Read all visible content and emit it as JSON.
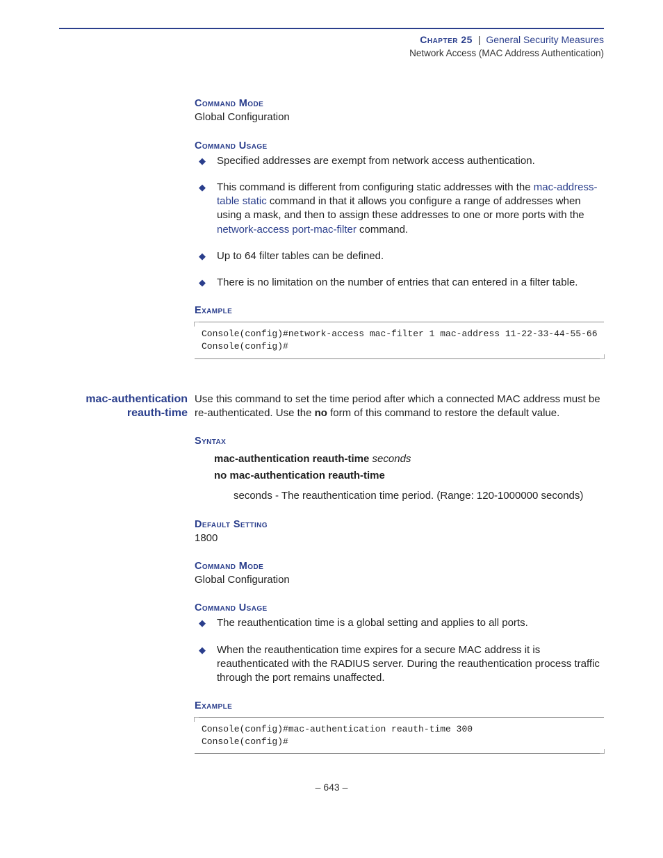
{
  "header": {
    "chapter_label": "Chapter 25",
    "separator": "|",
    "chapter_title": "General Security Measures",
    "subtitle": "Network Access (MAC Address Authentication)"
  },
  "sec1": {
    "command_mode_head": "Command Mode",
    "command_mode_text": "Global Configuration",
    "command_usage_head": "Command Usage",
    "usage_items": {
      "0": {
        "text": "Specified addresses are exempt from network access authentication."
      },
      "1": {
        "pre": "This command is different from configuring static addresses with the ",
        "link1": "mac-address-table static",
        "mid": " command in that it allows you configure a range of addresses when using a mask, and then to assign these addresses to one or more ports with the ",
        "link2": "network-access port-mac-filter",
        "post": " command."
      },
      "2": {
        "text": "Up to 64 filter tables can be defined."
      },
      "3": {
        "text": "There is no limitation on the number of entries that can entered in a filter table."
      }
    },
    "example_head": "Example",
    "example_code": "Console(config)#network-access mac-filter 1 mac-address 11-22-33-44-55-66\nConsole(config)#"
  },
  "sec2": {
    "margin_title_l1": "mac-authentication",
    "margin_title_l2": "reauth-time",
    "intro_pre": "Use this command to set the time period after which a connected MAC address must be re-authenticated. Use the ",
    "intro_bold": "no",
    "intro_post": " form of this command to restore the default value.",
    "syntax_head": "Syntax",
    "syntax_l1_bold": "mac-authentication reauth-time",
    "syntax_l1_ital": "seconds",
    "syntax_l2_bold": "no mac-authentication reauth-time",
    "param_ital": "seconds",
    "param_text": " - The reauthentication time period. (Range: 120-1000000 seconds)",
    "default_head": "Default Setting",
    "default_text": "1800",
    "command_mode_head": "Command Mode",
    "command_mode_text": "Global Configuration",
    "command_usage_head": "Command Usage",
    "usage_items": {
      "0": {
        "text": "The reauthentication time is a global setting and applies to all ports."
      },
      "1": {
        "text": "When the reauthentication time expires for a secure MAC address it is reauthenticated with the RADIUS server. During the reauthentication process traffic through the port remains unaffected."
      }
    },
    "example_head": "Example",
    "example_code": "Console(config)#mac-authentication reauth-time 300\nConsole(config)#"
  },
  "footer": {
    "page_number": "–  643  –"
  }
}
